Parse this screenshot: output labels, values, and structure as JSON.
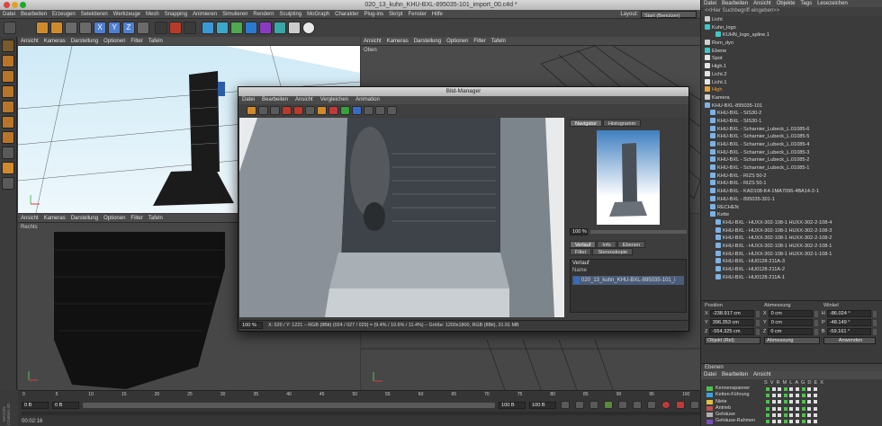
{
  "window": {
    "title": "020_13_kuhn_KHU-BXL-895035-101_import_00.c4d *"
  },
  "menubar": [
    "Datei",
    "Bearbeiten",
    "Erzeugen",
    "Selektieren",
    "Werkzeuge",
    "Mesh",
    "Snapping",
    "Animieren",
    "Simulieren",
    "Rendern",
    "Sculpting",
    "MoGraph",
    "Charakter",
    "Plug-ins",
    "Skript",
    "Fenster",
    "Hilfe"
  ],
  "layout": {
    "label": "Layout:",
    "value": "Start (Benutzer)"
  },
  "toolbar": {
    "x": "X",
    "y": "Y",
    "z": "Z"
  },
  "viewport_menu": [
    "Ansicht",
    "Kameras",
    "Darstellung",
    "Optionen",
    "Filter",
    "Tafeln"
  ],
  "viewports": {
    "top_right_label": "Oben",
    "bottom_left_label": "Rechts"
  },
  "picture_manager": {
    "title": "Bild-Manager",
    "menu": [
      "Datei",
      "Bearbeiten",
      "Ansicht",
      "Vergleichen",
      "Animation"
    ],
    "tabs": [
      "Navigator",
      "Histogramm"
    ],
    "zoom": "100 %",
    "sub_tabs_row1": [
      "Verlauf",
      "Info",
      "Ebenen"
    ],
    "sub_tabs_row2": [
      "Filter",
      "Stereoskopie"
    ],
    "history_header": "Verlauf",
    "name_col": "Name",
    "history_item": "020_13_kuhn_KHU-BXL-895035-101_i",
    "status_zoom": "100 %",
    "status_text": "X: 520 / Y: 1221 – RGB (8Bit) (024 / 027 / 029) = (9.4% / 10.6% / 11.4%) – Größe: 1200x1800, RGB (8Bit), 31.91 MB"
  },
  "object_manager": {
    "menu": [
      "Datei",
      "Bearbeiten",
      "Ansicht",
      "Objekte",
      "Tags",
      "Lesezeichen"
    ],
    "search_placeholder": "<<Hier Suchbegriff eingeben>>",
    "items": [
      {
        "label": "Licht",
        "color": "#cfcfcf",
        "indent": 0
      },
      {
        "label": "Kuhn_logo",
        "color": "#3ec7c7",
        "indent": 0
      },
      {
        "label": "KUHN_logo_spline.1",
        "color": "#3ec7c7",
        "indent": 2
      },
      {
        "label": "Rom_dyn",
        "color": "#cfcfcf",
        "indent": 0
      },
      {
        "label": "Ebene",
        "color": "#3ec7c7",
        "indent": 0
      },
      {
        "label": "Spot",
        "color": "#e6e6e6",
        "indent": 0
      },
      {
        "label": "High.1",
        "color": "#e6e6e6",
        "indent": 0
      },
      {
        "label": "Licht.2",
        "color": "#e6e6e6",
        "indent": 0
      },
      {
        "label": "Licht.1",
        "color": "#e6e6e6",
        "indent": 0
      },
      {
        "label": "High",
        "color": "#e6a43c",
        "indent": 0
      },
      {
        "label": "Kamera",
        "color": "#cfcfcf",
        "indent": 0
      },
      {
        "label": "KHU-BXL-895035-101",
        "color": "#7ab4e6",
        "indent": 0
      },
      {
        "label": "KHU-BXL - SIS30-2",
        "color": "#7ab4e6",
        "indent": 1
      },
      {
        "label": "KHU-BXL - SIS30-1",
        "color": "#7ab4e6",
        "indent": 1
      },
      {
        "label": "KHU-BXL - Scharnier_Lubeck_L.01085-6",
        "color": "#7ab4e6",
        "indent": 1
      },
      {
        "label": "KHU-BXL - Scharnier_Lubeck_L.01085-5",
        "color": "#7ab4e6",
        "indent": 1
      },
      {
        "label": "KHU-BXL - Scharnier_Lubeck_L.01085-4",
        "color": "#7ab4e6",
        "indent": 1
      },
      {
        "label": "KHU-BXL - Scharnier_Lubeck_L.01085-3",
        "color": "#7ab4e6",
        "indent": 1
      },
      {
        "label": "KHU-BXL - Scharnier_Lubeck_L.01085-2",
        "color": "#7ab4e6",
        "indent": 1
      },
      {
        "label": "KHU-BXL - Scharnier_Lubeck_L.01085-1",
        "color": "#7ab4e6",
        "indent": 1
      },
      {
        "label": "KHU-BXL - RIZS 50-2",
        "color": "#7ab4e6",
        "indent": 1
      },
      {
        "label": "KHU-BXL - RIZS 50-1",
        "color": "#7ab4e6",
        "indent": 1
      },
      {
        "label": "KHU-BXL - KAD108-K4-1MA7096-4BA14-2-1",
        "color": "#7ab4e6",
        "indent": 1
      },
      {
        "label": "KHU-BXL - 895035-301-1",
        "color": "#7ab4e6",
        "indent": 1
      },
      {
        "label": "RECHEN",
        "color": "#7ab4e6",
        "indent": 1
      },
      {
        "label": "Kette",
        "color": "#7ab4e6",
        "indent": 1
      },
      {
        "label": "KHU-BXL - HUXX-302-108-1 HUXX-302-2-108-4",
        "color": "#7ab4e6",
        "indent": 2
      },
      {
        "label": "KHU-BXL - HUXX-302-108-1 HUXX-302-2-108-3",
        "color": "#7ab4e6",
        "indent": 2
      },
      {
        "label": "KHU-BXL - HUXX-302-108-1 HUXX-302-2-108-2",
        "color": "#7ab4e6",
        "indent": 2
      },
      {
        "label": "KHU-BXL - HUXX-302-108-1 HUXX-302-2-108-1",
        "color": "#7ab4e6",
        "indent": 2
      },
      {
        "label": "KHU-BXL - HUXX-302-108-1 HUXX-302-1-108-1",
        "color": "#7ab4e6",
        "indent": 2
      },
      {
        "label": "KHU-BXL - HU0128-211A-3",
        "color": "#7ab4e6",
        "indent": 2
      },
      {
        "label": "KHU-BXL - HU0128-211A-2",
        "color": "#7ab4e6",
        "indent": 2
      },
      {
        "label": "KHU-BXL - HU0128-211A-1",
        "color": "#7ab4e6",
        "indent": 2
      }
    ]
  },
  "coordinates": {
    "headers": [
      "Position",
      "Abmessung",
      "Winkel"
    ],
    "rows": [
      {
        "axis": "X",
        "pos": "-238.917 cm",
        "size_axis": "X",
        "size": "0 cm",
        "ang_axis": "H",
        "ang": "-86.024 °"
      },
      {
        "axis": "Y",
        "pos": "396.353 cm",
        "size_axis": "Y",
        "size": "0 cm",
        "ang_axis": "P",
        "ang": "-48.149 °"
      },
      {
        "axis": "Z",
        "pos": "-554.325 cm",
        "size_axis": "Z",
        "size": "0 cm",
        "ang_axis": "B",
        "ang": "-59.161 °"
      }
    ],
    "mode": "Objekt (Rel)",
    "size_mode": "Abmessung",
    "apply": "Anwenden"
  },
  "layers": {
    "title": "Ebenen",
    "menu": [
      "Datei",
      "Bearbeiten",
      "Ansicht"
    ],
    "cols": [
      "S",
      "V",
      "R",
      "M",
      "L",
      "A",
      "G",
      "D",
      "E",
      "X"
    ],
    "items": [
      {
        "label": "Kennenspanner",
        "color": "#4fc04f"
      },
      {
        "label": "Ketten-Führung",
        "color": "#3ea0e0"
      },
      {
        "label": "Niete",
        "color": "#e0c040"
      },
      {
        "label": "Antrieb",
        "color": "#c04f4f"
      },
      {
        "label": "Gehäuse",
        "color": "#b0b0b0"
      },
      {
        "label": "Gehäuse-Rahmen",
        "color": "#7a4fc0"
      }
    ]
  },
  "timeline": {
    "ticks": [
      "0",
      "5",
      "10",
      "15",
      "20",
      "25",
      "30",
      "35",
      "40",
      "45",
      "50",
      "55",
      "60",
      "65",
      "70",
      "75",
      "80",
      "85",
      "90",
      "95",
      "100"
    ],
    "frame_start": "0 B",
    "frame_current": "0 B",
    "frame_end": "100 B",
    "frame_end2": "100 B",
    "frame_display": "0 B",
    "time": "00:02:16"
  },
  "branding": "MAXON CINEMA 4D"
}
